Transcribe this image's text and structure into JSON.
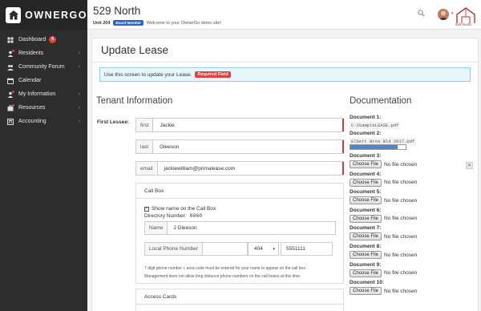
{
  "app": {
    "name": "OWNERGO"
  },
  "sidebar": {
    "items": [
      {
        "label": "Dashboard",
        "badge": "5",
        "chevron": false
      },
      {
        "label": "Residents",
        "badge": null,
        "chevron": true
      },
      {
        "label": "Community Forum",
        "badge": null,
        "chevron": true
      },
      {
        "label": "Calendar",
        "badge": null,
        "chevron": false
      },
      {
        "label": "My Information",
        "badge": null,
        "chevron": true
      },
      {
        "label": "Resources",
        "badge": null,
        "chevron": true
      },
      {
        "label": "Accounting",
        "badge": null,
        "chevron": true
      }
    ]
  },
  "header": {
    "property": "529 North",
    "unit": "Unit 204",
    "role_badge": "Board Member",
    "welcome": "Welcome to your OwnerGo demo site!",
    "brand_text": "529 North"
  },
  "page": {
    "title": "Update Lease",
    "info": "Use this screen to update your Lease.",
    "required_badge": "Required Field"
  },
  "tenant": {
    "heading": "Tenant Information",
    "first_lessee_label": "First Lessee:",
    "first_label": "first",
    "first_value": "Jackie",
    "last_label": "last",
    "last_value": "Gleeson",
    "email_label": "email",
    "email_value": "jackiewilliam@primalease.com"
  },
  "callbox": {
    "heading": "Call Box",
    "show_name_label": "Show name on the Call Box",
    "show_name_checked": true,
    "directory_label": "Directory Number:",
    "directory_number": "0060",
    "name_label": "Name",
    "name_value": "J Gleeson",
    "phone_label": "Local Phone Number",
    "area_code": "404",
    "phone_value": "5551111",
    "hint1": "7 digit phone number + area code must be entered for your name to appear on the call box.",
    "hint2": "Management does not allow long distance phone numbers on the call boxes at this time."
  },
  "access": {
    "heading": "Access Cards"
  },
  "documentation": {
    "heading": "Documentation",
    "doc1_label": "Document 1:",
    "doc1_file": "C-2SampleLEASE.pdf",
    "doc2_label": "Document 2:",
    "doc2_file": "Elbert Bros Bld 2017.pdf",
    "doc2_progress": 0.86,
    "choose_label": "Choose File",
    "no_file": "No file chosen",
    "empty_docs": [
      "Document 3:",
      "Document 4:",
      "Document 5:",
      "Document 6:",
      "Document 7:",
      "Document 8:",
      "Document 9:",
      "Document 10:"
    ]
  },
  "colors": {
    "required": "#d9363e",
    "accent": "#2a64c9",
    "info_bg": "#e6f6fc"
  }
}
